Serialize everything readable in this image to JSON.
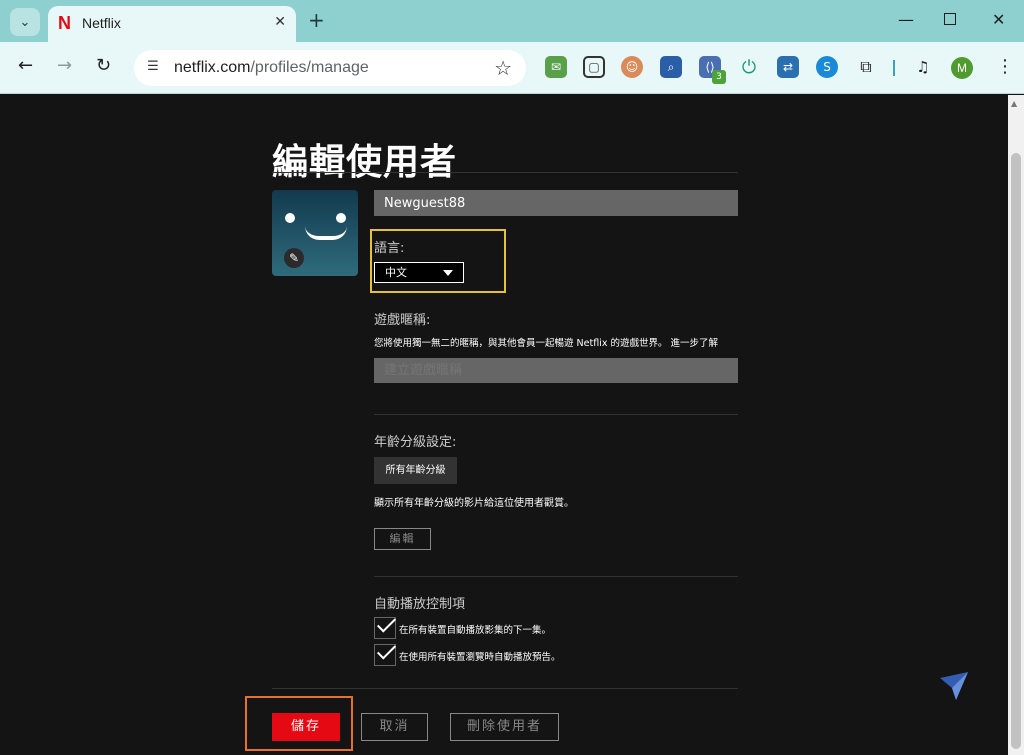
{
  "browser": {
    "tab_title": "Netflix",
    "favicon_letter": "N",
    "url_domain": "netflix.com",
    "url_path": "/profiles/manage",
    "extension_badge": "3",
    "profile_initial": "M"
  },
  "page": {
    "heading": "編輯使用者",
    "profile_name": "Newguest88",
    "language": {
      "label": "語言:",
      "selected": "中文"
    },
    "gamer_handle": {
      "label": "遊戲暱稱:",
      "hint": "您將使用獨一無二的暱稱，與其他會員一起暢遊 Netflix 的遊戲世界。 進一步了解",
      "placeholder": "建立遊戲暱稱"
    },
    "maturity": {
      "label": "年齡分級設定:",
      "button": "所有年齡分級",
      "description": "顯示所有年齡分級的影片給這位使用者觀賞。",
      "edit_button": "編輯"
    },
    "autoplay": {
      "label": "自動播放控制項",
      "option1": "在所有裝置自動播放影集的下一集。",
      "option2": "在使用所有裝置瀏覽時自動播放預告。",
      "option1_checked": true,
      "option2_checked": true
    },
    "buttons": {
      "save": "儲存",
      "cancel": "取消",
      "delete": "刪除使用者"
    }
  },
  "colors": {
    "netflix_red": "#e50914",
    "highlight_yellow": "#e8c13a",
    "highlight_orange": "#e8702a",
    "page_bg": "#141414"
  }
}
